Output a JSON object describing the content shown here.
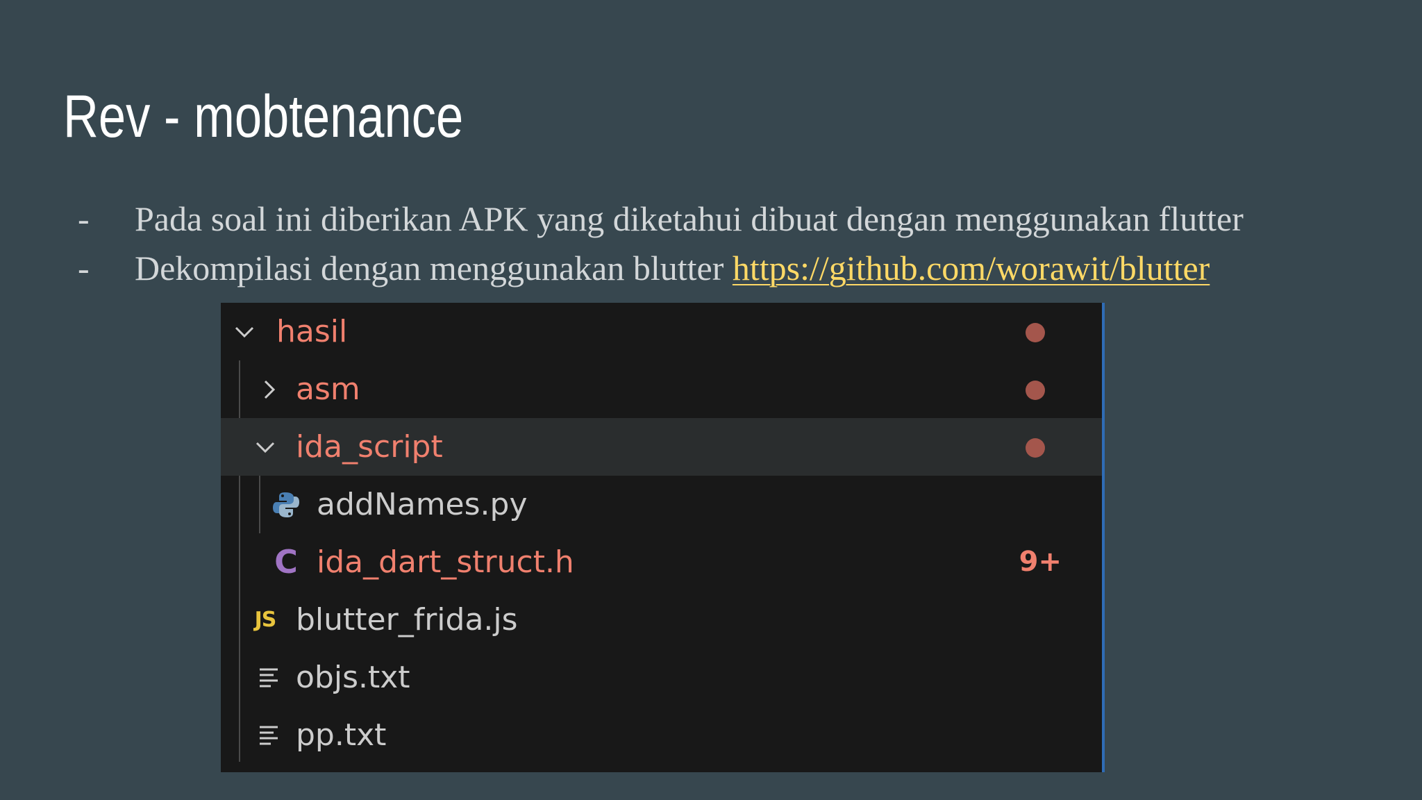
{
  "slide": {
    "title": "Rev - mobtenance",
    "bullets": [
      {
        "dash": "-",
        "text": "Pada soal ini diberikan APK yang diketahui dibuat dengan menggunakan flutter"
      },
      {
        "dash": "-",
        "text": "Dekompilasi dengan menggunakan blutter ",
        "link": "https://github.com/worawit/blutter"
      }
    ]
  },
  "explorer": {
    "items": [
      {
        "label": "hasil",
        "kind": "folder",
        "expanded": true,
        "status": "modified-dot"
      },
      {
        "label": "asm",
        "kind": "folder",
        "expanded": false,
        "status": "modified-dot"
      },
      {
        "label": "ida_script",
        "kind": "folder",
        "expanded": true,
        "status": "modified-dot",
        "selected": true
      },
      {
        "label": "addNames.py",
        "kind": "file",
        "icon": "python-icon"
      },
      {
        "label": "ida_dart_struct.h",
        "kind": "file",
        "icon": "c-file-icon",
        "icon_text": "C",
        "badge": "9+"
      },
      {
        "label": "blutter_frida.js",
        "kind": "file",
        "icon": "javascript-icon",
        "icon_text": "JS"
      },
      {
        "label": "objs.txt",
        "kind": "file",
        "icon": "text-file-icon"
      },
      {
        "label": "pp.txt",
        "kind": "file",
        "icon": "text-file-icon"
      }
    ]
  },
  "colors": {
    "slide_background": "#37474f",
    "title_text": "#ffffff",
    "body_text": "#d3d7d9",
    "link": "#ffd966",
    "explorer_background": "#181818",
    "explorer_selected_row": "#2a2d2e",
    "modified_label": "#f0806e",
    "modified_dot": "#a4564c",
    "normal_label": "#cccccc",
    "accent_border": "#2f6cb5"
  }
}
